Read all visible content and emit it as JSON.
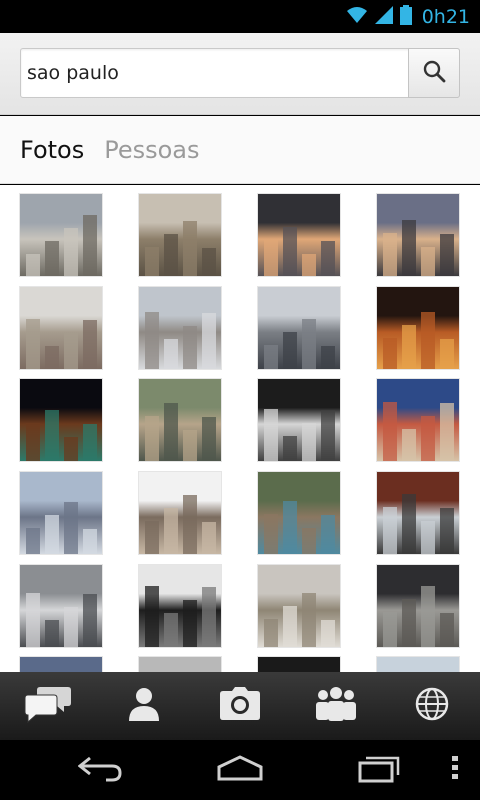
{
  "status_bar": {
    "time": "0h21"
  },
  "search": {
    "value": "sao paulo"
  },
  "tabs": [
    {
      "label": "Fotos",
      "active": true
    },
    {
      "label": "Pessoas",
      "active": false
    }
  ],
  "photos": [
    {
      "name": "photo-aerial-city-1",
      "colors": [
        "#9ea5ad",
        "#c8c4bc",
        "#6d6a62"
      ]
    },
    {
      "name": "photo-historic-building",
      "colors": [
        "#c7bfb2",
        "#8d7f6a",
        "#5b5245"
      ]
    },
    {
      "name": "photo-church-sunset",
      "colors": [
        "#303035",
        "#e0a777",
        "#565257"
      ]
    },
    {
      "name": "photo-palace-sky",
      "colors": [
        "#6a6f86",
        "#d9b18b",
        "#3c3a3e"
      ]
    },
    {
      "name": "photo-street-buildings",
      "colors": [
        "#dad8d4",
        "#a69c8e",
        "#7c6b61"
      ]
    },
    {
      "name": "photo-downtown-towers",
      "colors": [
        "#bfc5cc",
        "#8f8a85",
        "#d8dadd"
      ]
    },
    {
      "name": "photo-river-bridge",
      "colors": [
        "#c9cdd3",
        "#7b7f85",
        "#3d4148"
      ]
    },
    {
      "name": "photo-city-night-orange",
      "colors": [
        "#231510",
        "#b85b25",
        "#e6a04a"
      ]
    },
    {
      "name": "photo-night-lights-water",
      "colors": [
        "#0a0a10",
        "#6b3a1d",
        "#2c7a6a"
      ]
    },
    {
      "name": "photo-aerial-green",
      "colors": [
        "#7c8a6c",
        "#b6a48a",
        "#4f574c"
      ]
    },
    {
      "name": "photo-calcadao-pattern",
      "colors": [
        "#1c1c1c",
        "#d6d6d6",
        "#404040"
      ]
    },
    {
      "name": "photo-street-art",
      "colors": [
        "#2d4a88",
        "#c45a42",
        "#d6c3a8"
      ]
    },
    {
      "name": "photo-skyscrapers-blue",
      "colors": [
        "#a9b8cc",
        "#6c7588",
        "#d3d9e1"
      ]
    },
    {
      "name": "photo-kittens",
      "colors": [
        "#f2f2f2",
        "#7a6b5e",
        "#c7b7a4"
      ]
    },
    {
      "name": "photo-cat-grass",
      "colors": [
        "#5b6c4c",
        "#8b7761",
        "#4f8aa0"
      ]
    },
    {
      "name": "photo-market-red",
      "colors": [
        "#6b2e20",
        "#c9cfd4",
        "#3a3a3a"
      ]
    },
    {
      "name": "photo-bw-skyline",
      "colors": [
        "#8b8e92",
        "#d5d6d8",
        "#4a4c50"
      ]
    },
    {
      "name": "photo-bw-avenue",
      "colors": [
        "#e6e6e6",
        "#1e1e1e",
        "#7a7a7a"
      ]
    },
    {
      "name": "photo-city-daylight",
      "colors": [
        "#c9c5bf",
        "#8f8675",
        "#e0dcd5"
      ]
    },
    {
      "name": "photo-cloudy-sky",
      "colors": [
        "#2d2d30",
        "#9a9995",
        "#5c5a56"
      ]
    },
    {
      "name": "photo-partial-1",
      "colors": [
        "#5a6a8a",
        "#9aa6bd",
        "#3c4555"
      ]
    },
    {
      "name": "photo-partial-2",
      "colors": [
        "#b8b8b8",
        "#e0e0e0",
        "#777"
      ]
    },
    {
      "name": "photo-partial-3",
      "colors": [
        "#1a1a1a",
        "#3c3c3c",
        "#0a0a0a"
      ]
    },
    {
      "name": "photo-partial-4",
      "colors": [
        "#c7d2dc",
        "#8fa0ae",
        "#e7e7e7"
      ]
    }
  ],
  "bottom_nav": [
    {
      "name": "chat-icon"
    },
    {
      "name": "person-icon"
    },
    {
      "name": "camera-icon"
    },
    {
      "name": "group-icon"
    },
    {
      "name": "globe-icon"
    }
  ],
  "system_nav": [
    {
      "name": "back-icon"
    },
    {
      "name": "home-icon"
    },
    {
      "name": "recent-apps-icon"
    },
    {
      "name": "menu-icon"
    }
  ]
}
